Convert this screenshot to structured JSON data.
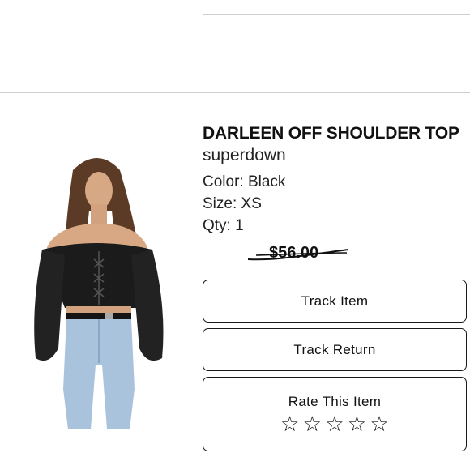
{
  "product": {
    "title": "DARLEEN OFF SHOULDER TOP",
    "brand": "superdown",
    "color": "Color: Black",
    "size": "Size: XS",
    "qty": "Qty: 1",
    "original_price": "$56.00"
  },
  "actions": {
    "track_item": "Track Item",
    "track_return": "Track Return",
    "rate_item": "Rate This Item",
    "rating": 0,
    "rating_max": 5,
    "star_glyph": "☆"
  }
}
